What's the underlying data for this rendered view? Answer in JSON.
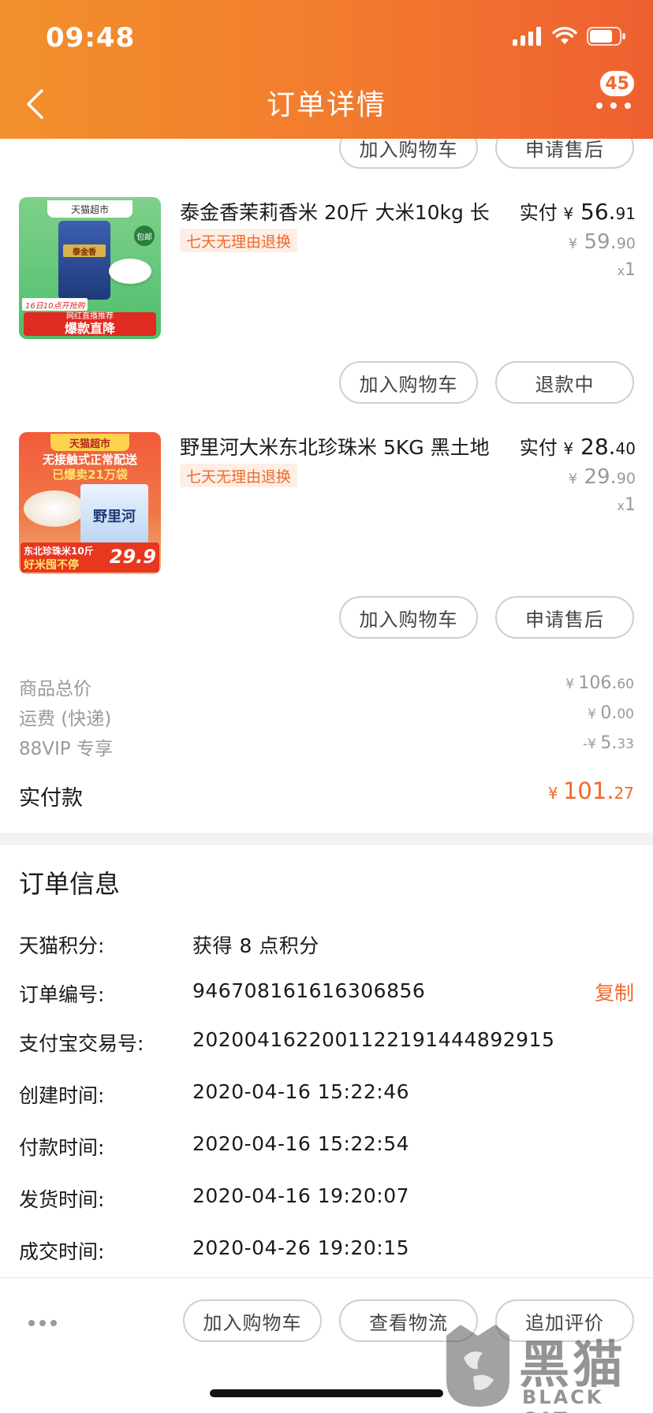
{
  "status_bar": {
    "time": "09:48"
  },
  "header": {
    "title": "订单详情",
    "badge_count": "45"
  },
  "top_actions": {
    "add_cart": "加入购物车",
    "after_sale": "申请售后"
  },
  "items": [
    {
      "title": "泰金香茉莉香米 20斤 大米10kg 长",
      "return_tag": "七天无理由退换",
      "paid_label": "实付",
      "paid_yen": "¥",
      "paid_int": " 56.",
      "paid_dec": "91",
      "orig_yen": "¥",
      "orig_int": " 59.",
      "orig_dec": "90",
      "qty_x": "x",
      "qty": "1",
      "thumb": {
        "store": "天猫超市",
        "brand": "泰金香",
        "promo_small": "16日10点开抢购",
        "promo_line": "网红直播推荐",
        "promo_main": "爆款直降",
        "badge": "包邮"
      },
      "btn_add_cart": "加入购物车",
      "btn_status": "退款中"
    },
    {
      "title": "野里河大米东北珍珠米 5KG 黑土地",
      "return_tag": "七天无理由退换",
      "paid_label": "实付",
      "paid_yen": "¥",
      "paid_int": " 28.",
      "paid_dec": "40",
      "orig_yen": "¥",
      "orig_int": " 29.",
      "orig_dec": "90",
      "qty_x": "x",
      "qty": "1",
      "thumb": {
        "store": "天猫超市",
        "line1": "无接触式正常配送",
        "line2": "已爆卖21万袋",
        "bag": "野里河",
        "tag1": "东北珍珠米10斤",
        "tag2": "好米囤不停",
        "price": "29.9"
      },
      "btn_add_cart": "加入购物车",
      "btn_status": "申请售后"
    }
  ],
  "summary": {
    "rows": [
      {
        "label": "商品总价",
        "yen": "¥ ",
        "int": "106.",
        "dec": "60"
      },
      {
        "label": "运费 (快递)",
        "yen": "¥ ",
        "int": "0.",
        "dec": "00"
      },
      {
        "label": "88VIP 专享",
        "yen": "-¥ ",
        "int": "5.",
        "dec": "33"
      }
    ],
    "total_label": "实付款",
    "total_yen": "¥ ",
    "total_int": "101.",
    "total_dec": "27"
  },
  "order_info": {
    "heading": "订单信息",
    "rows": [
      {
        "label": "天猫积分:",
        "value": "获得 8 点积分"
      },
      {
        "label": "订单编号:",
        "value": "946708161616306856"
      },
      {
        "label": "支付宝交易号:",
        "value": "2020041622001122191444892915"
      },
      {
        "label": "创建时间:",
        "value": "2020-04-16 15:22:46"
      },
      {
        "label": "付款时间:",
        "value": "2020-04-16 15:22:54"
      },
      {
        "label": "发货时间:",
        "value": "2020-04-16 19:20:07"
      },
      {
        "label": "成交时间:",
        "value": "2020-04-26 19:20:15"
      }
    ],
    "copy": "复制"
  },
  "bottom_bar": {
    "add_cart": "加入购物车",
    "logistics": "查看物流",
    "review": "追加评价"
  },
  "watermark": {
    "text": "黑猫",
    "sub": "BLACK CAT"
  },
  "colors": {
    "accent": "#f06a2a",
    "header_start": "#f2902c",
    "header_end": "#ee5f30"
  }
}
